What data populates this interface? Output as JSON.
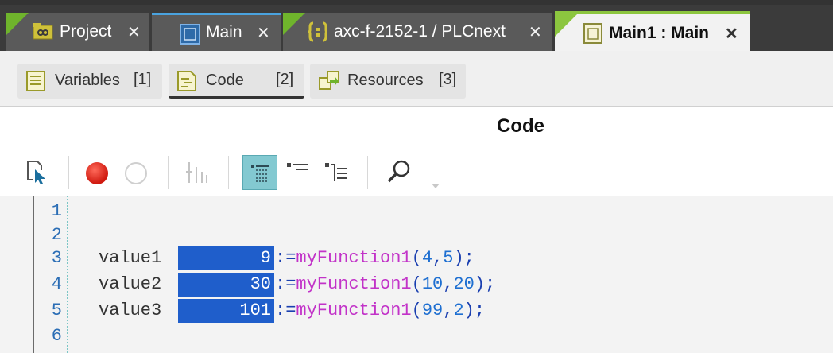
{
  "tabs": [
    {
      "label": "Project",
      "icon": "project-icon",
      "close": "✕"
    },
    {
      "label": "Main",
      "icon": "window-icon",
      "close": "✕"
    },
    {
      "label": "axc-f-2152-1 / PLCnext",
      "icon": "device-brackets-icon",
      "close": "✕"
    },
    {
      "label": "Main1 : Main",
      "icon": "program-instance-icon",
      "close": "✕",
      "active": true
    }
  ],
  "subtabs": [
    {
      "label": "Variables",
      "count": "[1]",
      "icon": "variables-list-icon"
    },
    {
      "label": "Code",
      "count": "[2]",
      "icon": "code-sheet-icon",
      "selected": true
    },
    {
      "label": "Resources",
      "count": "[3]",
      "icon": "resources-icon"
    }
  ],
  "panel": {
    "title": "Code"
  },
  "toolbar": [
    "select-pointer-icon",
    "breakpoint-red-icon",
    "breakpoint-empty-icon",
    "step-columns-icon",
    "grid-highlight-icon",
    "collapse-lines-icon",
    "expand-tree-icon",
    "search-icon",
    "dropdown-caret-icon"
  ],
  "editor": {
    "lines": [
      {
        "n": "1"
      },
      {
        "n": "2"
      },
      {
        "n": "3",
        "var": "value1",
        "value": "9",
        "assign": ":=",
        "fn": "myFunction1",
        "open": "(",
        "a": "4",
        "comma": ",",
        "b": "5",
        "close": ");"
      },
      {
        "n": "4",
        "var": "value2",
        "value": "30",
        "assign": ":=",
        "fn": "myFunction1",
        "open": "(",
        "a": "10",
        "comma": ",",
        "b": "20",
        "close": ");"
      },
      {
        "n": "5",
        "var": "value3",
        "value": "101",
        "assign": ":=",
        "fn": "myFunction1",
        "open": "(",
        "a": "99",
        "comma": ",",
        "b": "2",
        "close": ");"
      },
      {
        "n": "6"
      }
    ]
  },
  "colors": {
    "tab_accent_green": "#8cc63f",
    "tab_accent_blue": "#4aa3df",
    "value_box": "#1f5ecb",
    "function_color": "#c233c8",
    "number_color": "#1e6fd1",
    "line_number_color": "#2a6db5",
    "breakpoint_red": "#e0241b"
  }
}
